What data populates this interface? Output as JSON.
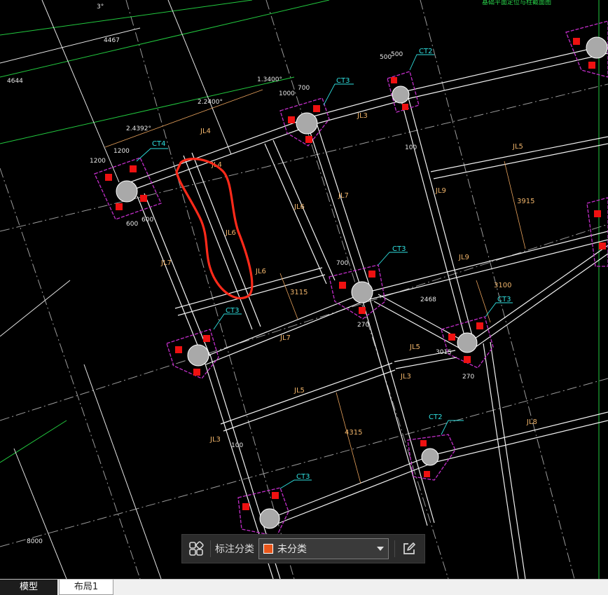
{
  "drawing": {
    "pile_cap_labels": [
      "CT4",
      "CT2",
      "CT3",
      "CT3",
      "CT3",
      "CT3",
      "CT3",
      "CT2"
    ],
    "beam_labels": [
      "JL4",
      "JL4",
      "JL6",
      "JL6",
      "JL7",
      "JL7",
      "JL6",
      "JL7",
      "JL5",
      "JL5",
      "JL5",
      "JL3",
      "JL3",
      "JL9",
      "JL9",
      "JL8",
      "JL3"
    ],
    "dimension_texts": [
      "2.4392°",
      "2.2400°",
      "1.3400°",
      "1200",
      "500",
      "500",
      "3915",
      "3115",
      "3100",
      "4315",
      "2468",
      "3015",
      "270",
      "270",
      "100",
      "100",
      "1200",
      "600",
      "600",
      "1000",
      "700",
      "700"
    ],
    "top_texts": [
      "3°",
      "4467",
      "4644",
      "8000"
    ],
    "top_right_note": "基础平面定位与柱截面图"
  },
  "toolbar": {
    "grid_icon": "four-squares-icon",
    "label": "标注分类",
    "category_value": "未分类",
    "category_color": "#e8561b",
    "edit_icon": "edit-icon"
  },
  "tabs": {
    "model": "模型",
    "layout1": "布局1"
  }
}
